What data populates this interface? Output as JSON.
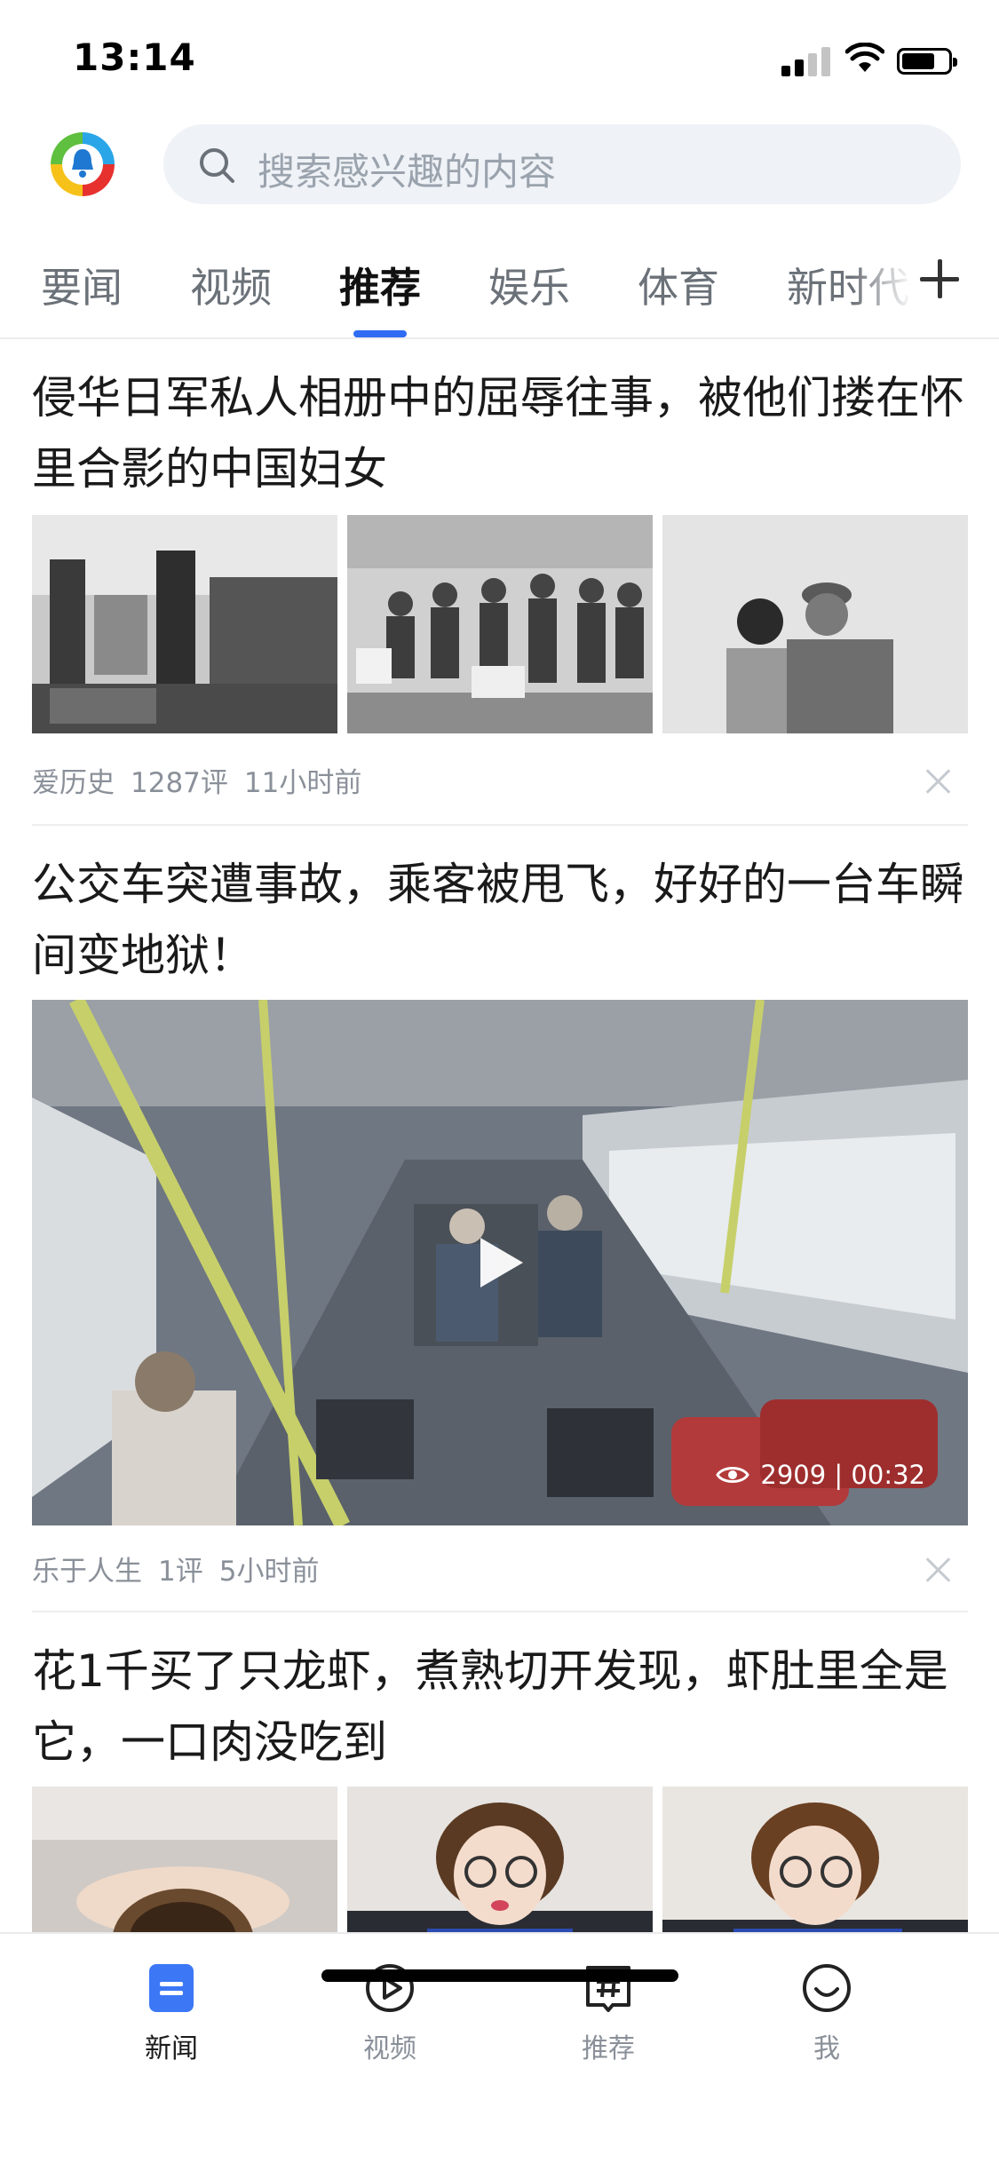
{
  "status_bar": {
    "time": "13:14"
  },
  "search": {
    "placeholder": "搜索感兴趣的内容"
  },
  "tabs": [
    {
      "label": "要闻"
    },
    {
      "label": "视频"
    },
    {
      "label": "推荐"
    },
    {
      "label": "娱乐"
    },
    {
      "label": "体育"
    },
    {
      "label": "新时代"
    }
  ],
  "active_tab": "推荐",
  "feed": [
    {
      "title": "侵华日军私人相册中的屈辱往事，被他们搂在怀里合影的中国妇女",
      "type": "gallery",
      "source": "爱历史",
      "comments": "1287评",
      "time": "11小时前"
    },
    {
      "title": "公交车突遭事故，乘客被甩飞，好好的一台车瞬间变地狱！",
      "type": "video",
      "views_duration": "2909 | 00:32",
      "source": "乐于人生",
      "comments": "1评",
      "time": "5小时前"
    },
    {
      "title": "花1千买了只龙虾，煮熟切开发现，虾肚里全是它，一口肉没吃到",
      "type": "gallery"
    }
  ],
  "bottom_nav": [
    {
      "label": "新闻",
      "icon": "news-icon"
    },
    {
      "label": "视频",
      "icon": "play-circle-icon"
    },
    {
      "label": "推荐",
      "icon": "hashtag-icon"
    },
    {
      "label": "我",
      "icon": "smile-icon"
    }
  ],
  "colors": {
    "accent": "#2f6bf3",
    "muted_text": "#8a9099",
    "search_bg": "#eff2f6"
  }
}
